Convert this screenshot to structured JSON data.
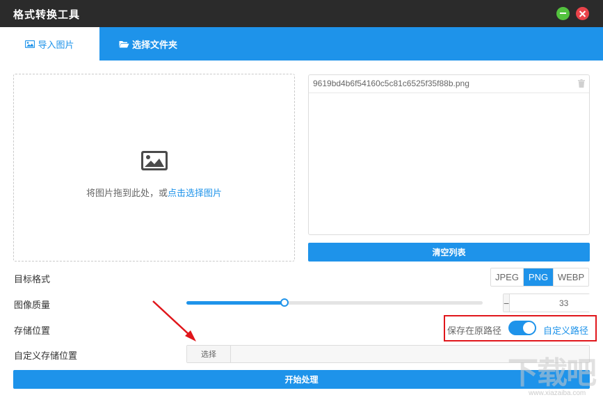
{
  "window": {
    "title": "格式转换工具"
  },
  "tabs": [
    {
      "label": "导入图片",
      "icon": "image-icon"
    },
    {
      "label": "选择文件夹",
      "icon": "folder-open-icon"
    }
  ],
  "dropzone": {
    "hint": "将图片拖到此处，或",
    "link": "点击选择图片",
    "icon": "image-icon"
  },
  "filelist": {
    "files": [
      "9619bd4b6f54160c5c81c6525f35f88b.png"
    ]
  },
  "buttons": {
    "clear": "清空列表",
    "start": "开始处理",
    "choose": "选择"
  },
  "settings": {
    "format_label": "目标格式",
    "formats": [
      "JPEG",
      "PNG",
      "WEBP"
    ],
    "selected_format": "PNG",
    "quality_label": "图像质量",
    "quality": 33,
    "quality_min_label": "−",
    "quality_plus_label": "+",
    "save_label": "存储位置",
    "save_original": "保存在原路径",
    "save_custom": "自定义路径",
    "custom_save_on": true,
    "custom_path_label": "自定义存储位置",
    "custom_path_value": ""
  },
  "watermark": {
    "text": "下载吧",
    "url": "www.xiazaiba.com"
  },
  "colors": {
    "accent": "#1e93ea",
    "titlebar": "#2b2b2b",
    "highlight": "#e0161b",
    "minimize": "#53c23e",
    "close": "#e9434a"
  }
}
